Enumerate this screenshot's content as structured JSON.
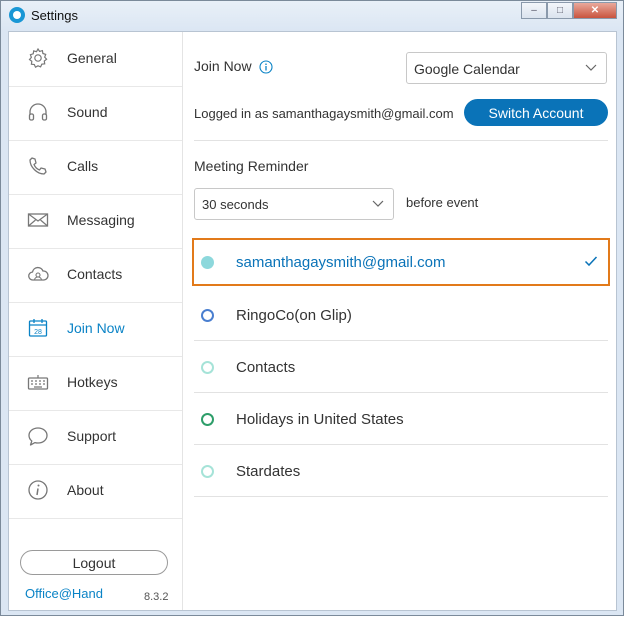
{
  "window": {
    "title": "Settings",
    "controls": {
      "minimize": "–",
      "maximize": "□",
      "close": "✕"
    }
  },
  "sidebar": {
    "items": [
      {
        "label": "General",
        "icon": "gear-icon"
      },
      {
        "label": "Sound",
        "icon": "headphones-icon"
      },
      {
        "label": "Calls",
        "icon": "phone-icon"
      },
      {
        "label": "Messaging",
        "icon": "envelope-icon"
      },
      {
        "label": "Contacts",
        "icon": "cloud-contacts-icon"
      },
      {
        "label": "Join Now",
        "icon": "calendar-icon",
        "active": true
      },
      {
        "label": "Hotkeys",
        "icon": "keyboard-icon"
      },
      {
        "label": "Support",
        "icon": "chat-bubble-icon"
      },
      {
        "label": "About",
        "icon": "info-icon"
      }
    ],
    "logout_label": "Logout",
    "brand": "Office@Hand",
    "version": "8.3.2"
  },
  "main": {
    "join_now_label": "Join Now",
    "calendar_select": "Google Calendar",
    "logged_in_text": "Logged in as samanthagaysmith@gmail.com",
    "switch_account_label": "Switch Account",
    "meeting_reminder_label": "Meeting Reminder",
    "reminder_select": "30 seconds",
    "before_event_label": "before event",
    "calendars": [
      {
        "name": "samanthagaysmith@gmail.com",
        "color": "#8dd8dc",
        "selected": true
      },
      {
        "name": "RingoCo(on Glip)",
        "color": "#4a7fd0",
        "selected": false
      },
      {
        "name": "Contacts",
        "color": "#8dd8d0",
        "selected": false
      },
      {
        "name": "Holidays in United States",
        "color": "#2e9e6a",
        "selected": false
      },
      {
        "name": "Stardates",
        "color": "#8dd8d0",
        "selected": false
      }
    ]
  },
  "colors": {
    "accent": "#0a73b8",
    "highlight": "#e27a1a"
  }
}
